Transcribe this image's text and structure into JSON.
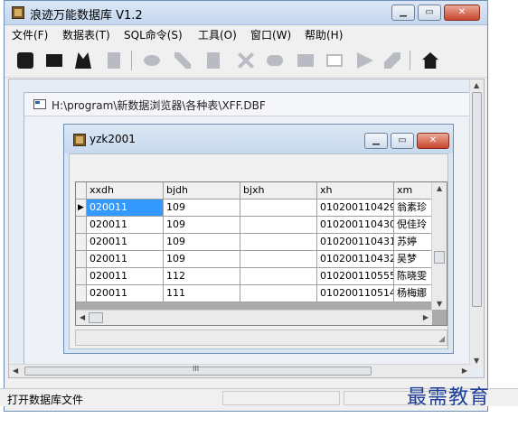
{
  "window": {
    "title": "浪迹万能数据库 V1.2",
    "controls": [
      "▁",
      "▭",
      "✕"
    ]
  },
  "menu": [
    {
      "label": "文件(F)"
    },
    {
      "label": "数据表(T)"
    },
    {
      "label": "SQL命令(S)"
    },
    {
      "label": "工具(O)"
    },
    {
      "label": "窗口(W)"
    },
    {
      "label": "帮助(H)"
    }
  ],
  "toolbar": {
    "icons": [
      "database-icon",
      "table-icon",
      "users-icon",
      "document-icon",
      "link-icon",
      "pencil-icon",
      "page-icon",
      "delete-icon",
      "chain-icon",
      "folder-icon",
      "window-icon",
      "play-icon",
      "wrench-icon",
      "home-icon"
    ]
  },
  "dbf_window": {
    "title": "H:\\program\\新数据浏览器\\各种表\\XFF.DBF"
  },
  "table_window": {
    "title": "yzk2001",
    "controls": [
      "▁",
      "▭",
      "✕"
    ],
    "columns": [
      "xxdh",
      "bjdh",
      "bjxh",
      "xh",
      "xm"
    ],
    "rows": [
      [
        "020011",
        "109",
        "",
        "010200110429",
        "翁素珍"
      ],
      [
        "020011",
        "109",
        "",
        "010200110430",
        "倪佳玲"
      ],
      [
        "020011",
        "109",
        "",
        "010200110431",
        "苏婷"
      ],
      [
        "020011",
        "109",
        "",
        "010200110432",
        "吴梦"
      ],
      [
        "020011",
        "112",
        "",
        "010200110555",
        "陈晓雯"
      ],
      [
        "020011",
        "111",
        "",
        "010200110514",
        "杨梅娜"
      ]
    ],
    "current_marker": "▶"
  },
  "mdi_scroll": {
    "h_thumb_label": "III"
  },
  "status": {
    "text": "打开数据库文件"
  },
  "watermark": {
    "text": "最需教育"
  }
}
